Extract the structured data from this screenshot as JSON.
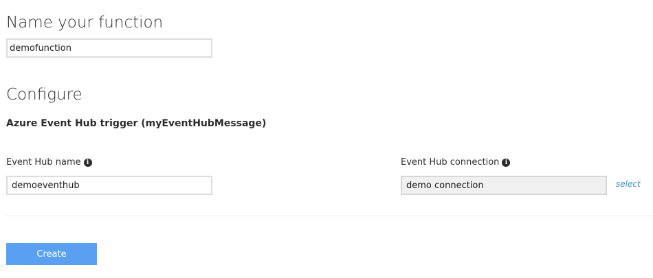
{
  "name_section": {
    "title": "Name your function",
    "function_name_value": "demofunction"
  },
  "configure_section": {
    "title": "Configure",
    "trigger_heading": "Azure Event Hub trigger (myEventHubMessage)",
    "event_hub_name": {
      "label": "Event Hub name",
      "value": "demoeventhub",
      "info_icon": "info-icon"
    },
    "event_hub_connection": {
      "label": "Event Hub connection",
      "value": "demo connection",
      "info_icon": "info-icon",
      "select_label": "select"
    }
  },
  "actions": {
    "create_label": "Create"
  },
  "colors": {
    "primary_button": "#5aa0f2",
    "link": "#2f8fd0",
    "readonly_input_bg": "#f0f0f0"
  }
}
